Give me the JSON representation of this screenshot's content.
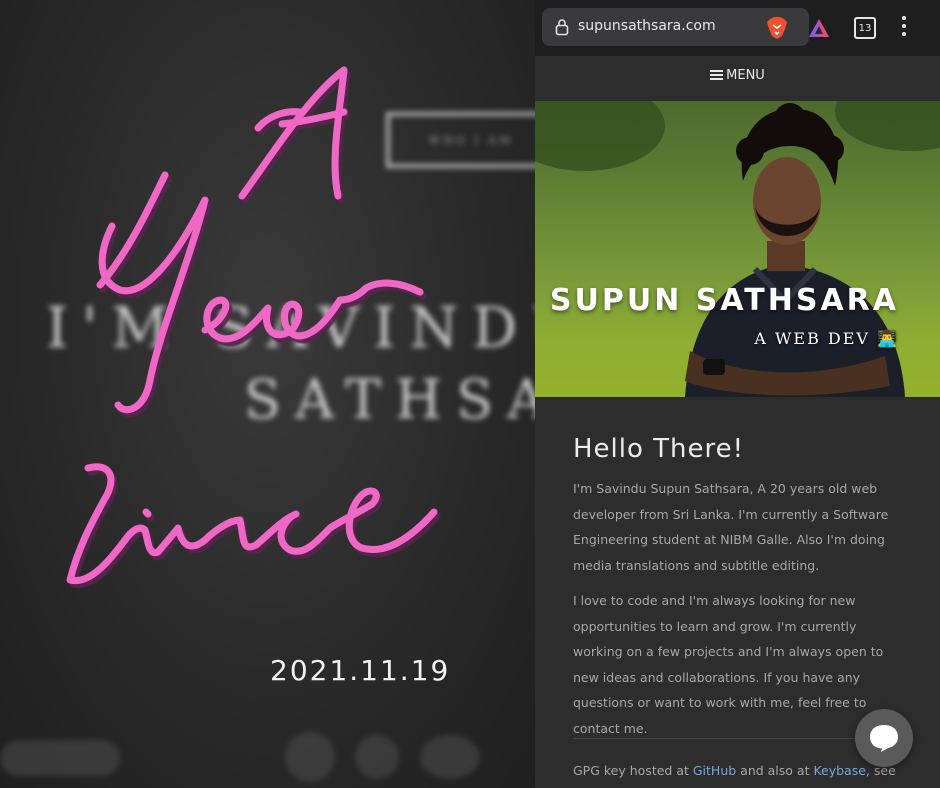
{
  "left": {
    "bg_button": "WHO I AM",
    "bg_line1": "I'M SAVINDU",
    "bg_line2": "SATHSA",
    "script_line1": "A",
    "script_line2": "Year",
    "script_line3": "since",
    "date": "2021.11.19",
    "script_color": "#ef67c6"
  },
  "browser": {
    "url": "supunsathsara.com",
    "tab_count": "13",
    "icons": [
      "lock-icon",
      "brave-lion-icon",
      "brave-rewards-icon",
      "tabs-icon",
      "kebab-menu-icon"
    ]
  },
  "site": {
    "menu_label": "MENU",
    "hero_name": "SUPUN SATHSARA",
    "hero_role": "A WEB DEV 👨‍💻",
    "heading": "Hello There!",
    "para1": "I'm Savindu Supun Sathsara, A 20 years old web developer from Sri Lanka. I'm currently a Software Engineering student at NIBM Galle. Also I'm doing media translations and subtitle editing.",
    "para2": "I love to code and I'm always looking for new opportunities to learn and grow. I'm currently working on a few projects and I'm always open to new ideas and collaborations. If you have any questions or want to work with me, feel free to contact me.",
    "gpg_prefix": "GPG key hosted at ",
    "gpg_link1": "GitHub",
    "gpg_mid": " and also at ",
    "gpg_link2": "Keybase",
    "gpg_suffix": ", see",
    "link_color": "#7aa7d9"
  }
}
